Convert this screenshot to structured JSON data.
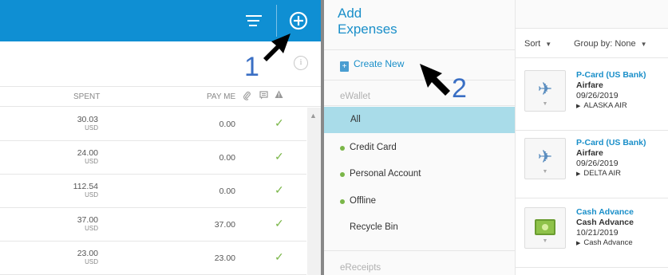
{
  "colors": {
    "topbar": "#0f8fd3",
    "accent": "#1a8fc9",
    "selected": "#a9dce9",
    "status_dot": "#7ab648",
    "annotation": "#3a6fc4"
  },
  "left_pane": {
    "sort_icon": "sort-lines-icon",
    "add_icon": "add-circle-icon",
    "info_icon": "info-icon",
    "columns": {
      "spent": "SPENT",
      "pay_me": "PAY ME"
    },
    "rows": [
      {
        "amount": "30.03",
        "currency": "USD",
        "pay_me": "0.00"
      },
      {
        "amount": "24.00",
        "currency": "USD",
        "pay_me": "0.00"
      },
      {
        "amount": "112.54",
        "currency": "USD",
        "pay_me": "0.00"
      },
      {
        "amount": "37.00",
        "currency": "USD",
        "pay_me": "37.00"
      },
      {
        "amount": "23.00",
        "currency": "USD",
        "pay_me": "23.00"
      }
    ]
  },
  "annotations": {
    "one": "1",
    "two": "2"
  },
  "middle_pane": {
    "title_line1": "Add",
    "title_line2": "Expenses",
    "create_new": "Create New",
    "ewallet_label": "eWallet",
    "items": [
      {
        "label": "All",
        "selected": true
      },
      {
        "label": "Credit Card",
        "dot": true
      },
      {
        "label": "Personal Account",
        "dot": true
      },
      {
        "label": "Offline",
        "dot": true
      },
      {
        "label": "Recycle Bin"
      }
    ],
    "ereceipts_label": "eReceipts"
  },
  "right_pane": {
    "sort_label": "Sort",
    "group_label": "Group by: None",
    "cards": [
      {
        "title": "P-Card (US Bank)",
        "type": "Airfare",
        "date": "09/26/2019",
        "merchant": "ALASKA AIR",
        "icon": "airplane-icon"
      },
      {
        "title": "P-Card (US Bank)",
        "type": "Airfare",
        "date": "09/26/2019",
        "merchant": "DELTA AIR",
        "icon": "airplane-icon"
      },
      {
        "title": "Cash Advance",
        "type": "Cash Advance",
        "date": "10/21/2019",
        "merchant": "Cash Advance",
        "icon": "cash-icon"
      }
    ]
  }
}
